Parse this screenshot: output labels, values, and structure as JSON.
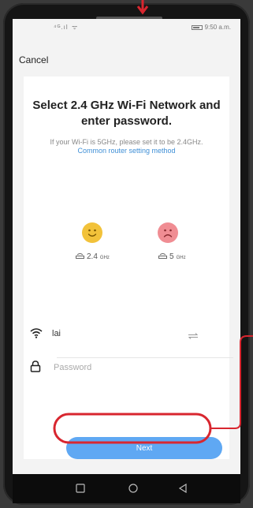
{
  "status_bar": {
    "signal": "⁴ᴳ.ıl",
    "wifi": "ᯤ",
    "time": "9:50 a.m."
  },
  "header": {
    "cancel_label": "Cancel"
  },
  "content": {
    "title": "Select 2.4 GHz Wi-Fi Network and enter password.",
    "desc_prefix": "If your Wi-Fi is 5GHz, please set it to be 2.4GHz.",
    "desc_link": "Common router setting method"
  },
  "bands": {
    "good": {
      "label": "2.4",
      "unit": "GHz",
      "face": "smiley-face-icon"
    },
    "bad": {
      "label": "5",
      "unit": "GHz",
      "face": "sad-face-icon"
    }
  },
  "form": {
    "ssid_value": "lai",
    "password_placeholder": "Password"
  },
  "actions": {
    "next_label": "Next"
  },
  "colors": {
    "accent": "#5fa8f3",
    "link": "#3f8fd6",
    "highlight_annotation": "#d8262f",
    "good_face": "#f2c23a",
    "bad_face": "#f08d93"
  }
}
